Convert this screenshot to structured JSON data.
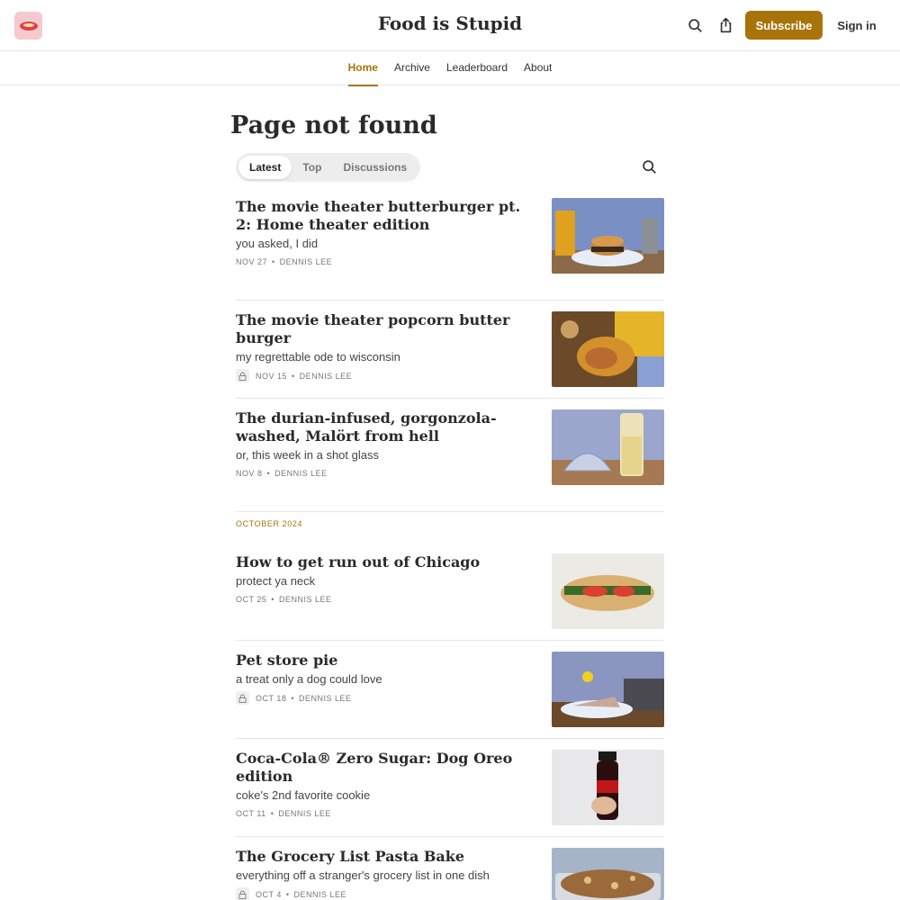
{
  "header": {
    "site_title": "Food is Stupid",
    "subscribe_label": "Subscribe",
    "signin_label": "Sign in",
    "accent_color": "#a8740a"
  },
  "nav": {
    "items": [
      {
        "label": "Home",
        "active": true
      },
      {
        "label": "Archive"
      },
      {
        "label": "Leaderboard"
      },
      {
        "label": "About"
      }
    ]
  },
  "main": {
    "page_title": "Page not found",
    "tabs": [
      {
        "label": "Latest",
        "active": true
      },
      {
        "label": "Top"
      },
      {
        "label": "Discussions"
      }
    ],
    "section_label": "OCTOBER 2024",
    "posts": [
      {
        "title": "The movie theater butterburger pt. 2: Home theater edition",
        "subtitle": "you asked, I did",
        "date": "NOV 27",
        "author": "DENNIS LEE",
        "locked": false
      },
      {
        "title": "The movie theater popcorn butter burger",
        "subtitle": "my regrettable ode to wisconsin",
        "date": "NOV 15",
        "author": "DENNIS LEE",
        "locked": true
      },
      {
        "title": "The durian-infused, gorgonzola-washed, Malört from hell",
        "subtitle": "or, this week in a shot glass",
        "date": "NOV 8",
        "author": "DENNIS LEE",
        "locked": false
      },
      {
        "title": "How to get run out of Chicago",
        "subtitle": "protect ya neck",
        "date": "OCT 25",
        "author": "DENNIS LEE",
        "locked": false
      },
      {
        "title": "Pet store pie",
        "subtitle": "a treat only a dog could love",
        "date": "OCT 18",
        "author": "DENNIS LEE",
        "locked": true
      },
      {
        "title": "Coca-Cola® Zero Sugar: Dog Oreo edition",
        "subtitle": "coke's 2nd favorite cookie",
        "date": "OCT 11",
        "author": "DENNIS LEE",
        "locked": false
      },
      {
        "title": "The Grocery List Pasta Bake",
        "subtitle": "everything off a stranger's grocery list in one dish",
        "date": "OCT 4",
        "author": "DENNIS LEE",
        "locked": true
      }
    ]
  }
}
